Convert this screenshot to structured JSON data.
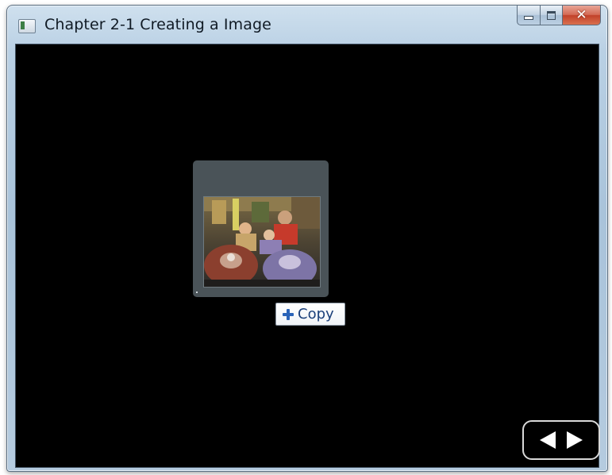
{
  "window": {
    "title": "Chapter 2-1 Creating a Image",
    "app_icon": "window-icon",
    "caption_buttons": [
      "minimize",
      "maximize",
      "close"
    ]
  },
  "canvas": {
    "background": "#000000",
    "image_tile": {
      "icon": "photo-thumbnail",
      "background": "#4a5358"
    },
    "drag_tooltip": {
      "icon": "plus-icon",
      "label": "Copy",
      "accent": "#2a63b8"
    },
    "navigation": {
      "previous_icon": "triangle-left-icon",
      "next_icon": "triangle-right-icon"
    }
  }
}
